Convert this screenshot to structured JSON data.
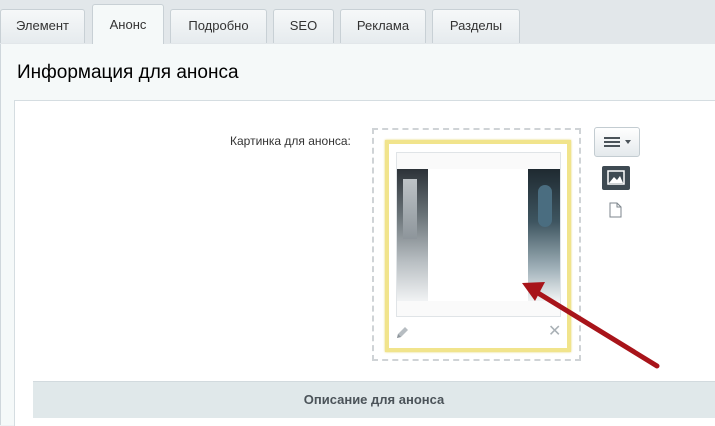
{
  "tabs": [
    {
      "label": "Элемент",
      "active": false
    },
    {
      "label": "Анонс",
      "active": true
    },
    {
      "label": "Подробно",
      "active": false
    },
    {
      "label": "SEO",
      "active": false
    },
    {
      "label": "Реклама",
      "active": false
    },
    {
      "label": "Разделы",
      "active": false
    }
  ],
  "section": {
    "title": "Информация для анонса"
  },
  "preview_picture": {
    "label": "Картинка для анонса:"
  },
  "description": {
    "header": "Описание для анонса"
  },
  "colors": {
    "highlight_border": "#f1e48c",
    "arrow": "#a8141a",
    "active_toggle": "#3e4a52"
  },
  "icons": [
    "edit-icon",
    "close-icon",
    "menu-icon",
    "image-icon",
    "file-icon",
    "arrow-annotation"
  ]
}
